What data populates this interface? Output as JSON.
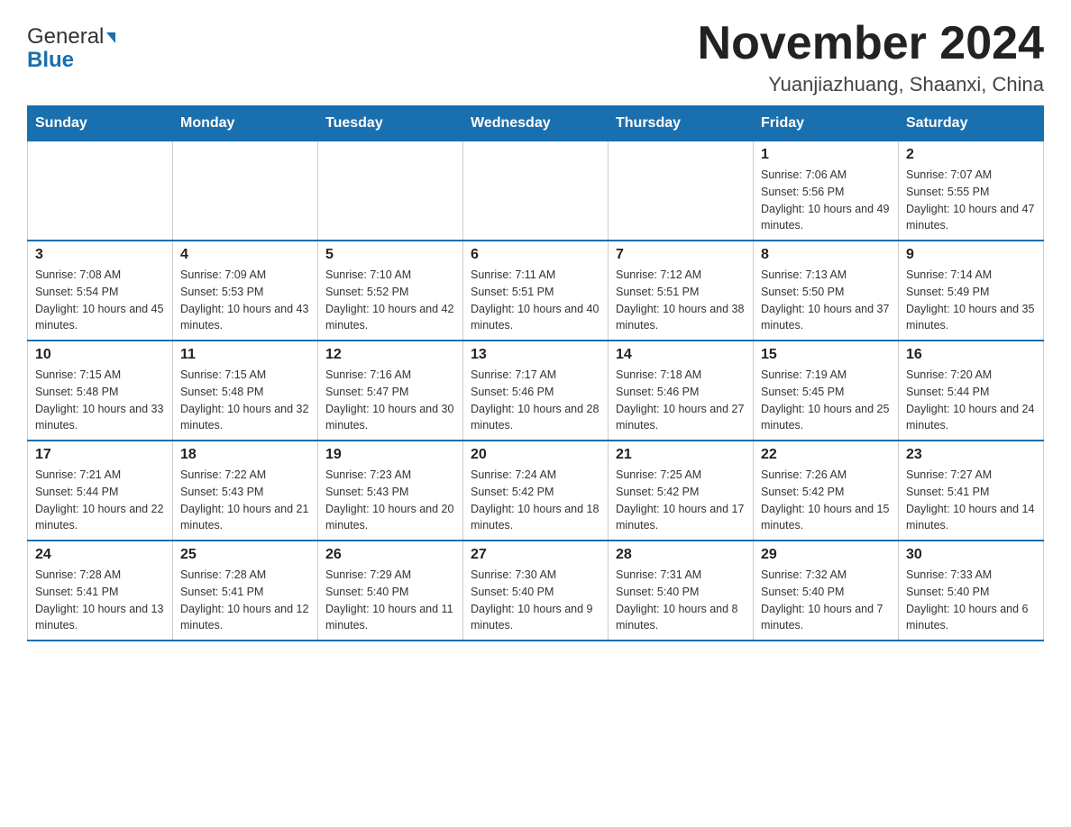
{
  "header": {
    "logo_general": "General",
    "logo_blue": "Blue",
    "month_year": "November 2024",
    "location": "Yuanjiazhuang, Shaanxi, China"
  },
  "weekdays": [
    "Sunday",
    "Monday",
    "Tuesday",
    "Wednesday",
    "Thursday",
    "Friday",
    "Saturday"
  ],
  "weeks": [
    [
      {
        "day": "",
        "info": ""
      },
      {
        "day": "",
        "info": ""
      },
      {
        "day": "",
        "info": ""
      },
      {
        "day": "",
        "info": ""
      },
      {
        "day": "",
        "info": ""
      },
      {
        "day": "1",
        "info": "Sunrise: 7:06 AM\nSunset: 5:56 PM\nDaylight: 10 hours and 49 minutes."
      },
      {
        "day": "2",
        "info": "Sunrise: 7:07 AM\nSunset: 5:55 PM\nDaylight: 10 hours and 47 minutes."
      }
    ],
    [
      {
        "day": "3",
        "info": "Sunrise: 7:08 AM\nSunset: 5:54 PM\nDaylight: 10 hours and 45 minutes."
      },
      {
        "day": "4",
        "info": "Sunrise: 7:09 AM\nSunset: 5:53 PM\nDaylight: 10 hours and 43 minutes."
      },
      {
        "day": "5",
        "info": "Sunrise: 7:10 AM\nSunset: 5:52 PM\nDaylight: 10 hours and 42 minutes."
      },
      {
        "day": "6",
        "info": "Sunrise: 7:11 AM\nSunset: 5:51 PM\nDaylight: 10 hours and 40 minutes."
      },
      {
        "day": "7",
        "info": "Sunrise: 7:12 AM\nSunset: 5:51 PM\nDaylight: 10 hours and 38 minutes."
      },
      {
        "day": "8",
        "info": "Sunrise: 7:13 AM\nSunset: 5:50 PM\nDaylight: 10 hours and 37 minutes."
      },
      {
        "day": "9",
        "info": "Sunrise: 7:14 AM\nSunset: 5:49 PM\nDaylight: 10 hours and 35 minutes."
      }
    ],
    [
      {
        "day": "10",
        "info": "Sunrise: 7:15 AM\nSunset: 5:48 PM\nDaylight: 10 hours and 33 minutes."
      },
      {
        "day": "11",
        "info": "Sunrise: 7:15 AM\nSunset: 5:48 PM\nDaylight: 10 hours and 32 minutes."
      },
      {
        "day": "12",
        "info": "Sunrise: 7:16 AM\nSunset: 5:47 PM\nDaylight: 10 hours and 30 minutes."
      },
      {
        "day": "13",
        "info": "Sunrise: 7:17 AM\nSunset: 5:46 PM\nDaylight: 10 hours and 28 minutes."
      },
      {
        "day": "14",
        "info": "Sunrise: 7:18 AM\nSunset: 5:46 PM\nDaylight: 10 hours and 27 minutes."
      },
      {
        "day": "15",
        "info": "Sunrise: 7:19 AM\nSunset: 5:45 PM\nDaylight: 10 hours and 25 minutes."
      },
      {
        "day": "16",
        "info": "Sunrise: 7:20 AM\nSunset: 5:44 PM\nDaylight: 10 hours and 24 minutes."
      }
    ],
    [
      {
        "day": "17",
        "info": "Sunrise: 7:21 AM\nSunset: 5:44 PM\nDaylight: 10 hours and 22 minutes."
      },
      {
        "day": "18",
        "info": "Sunrise: 7:22 AM\nSunset: 5:43 PM\nDaylight: 10 hours and 21 minutes."
      },
      {
        "day": "19",
        "info": "Sunrise: 7:23 AM\nSunset: 5:43 PM\nDaylight: 10 hours and 20 minutes."
      },
      {
        "day": "20",
        "info": "Sunrise: 7:24 AM\nSunset: 5:42 PM\nDaylight: 10 hours and 18 minutes."
      },
      {
        "day": "21",
        "info": "Sunrise: 7:25 AM\nSunset: 5:42 PM\nDaylight: 10 hours and 17 minutes."
      },
      {
        "day": "22",
        "info": "Sunrise: 7:26 AM\nSunset: 5:42 PM\nDaylight: 10 hours and 15 minutes."
      },
      {
        "day": "23",
        "info": "Sunrise: 7:27 AM\nSunset: 5:41 PM\nDaylight: 10 hours and 14 minutes."
      }
    ],
    [
      {
        "day": "24",
        "info": "Sunrise: 7:28 AM\nSunset: 5:41 PM\nDaylight: 10 hours and 13 minutes."
      },
      {
        "day": "25",
        "info": "Sunrise: 7:28 AM\nSunset: 5:41 PM\nDaylight: 10 hours and 12 minutes."
      },
      {
        "day": "26",
        "info": "Sunrise: 7:29 AM\nSunset: 5:40 PM\nDaylight: 10 hours and 11 minutes."
      },
      {
        "day": "27",
        "info": "Sunrise: 7:30 AM\nSunset: 5:40 PM\nDaylight: 10 hours and 9 minutes."
      },
      {
        "day": "28",
        "info": "Sunrise: 7:31 AM\nSunset: 5:40 PM\nDaylight: 10 hours and 8 minutes."
      },
      {
        "day": "29",
        "info": "Sunrise: 7:32 AM\nSunset: 5:40 PM\nDaylight: 10 hours and 7 minutes."
      },
      {
        "day": "30",
        "info": "Sunrise: 7:33 AM\nSunset: 5:40 PM\nDaylight: 10 hours and 6 minutes."
      }
    ]
  ]
}
